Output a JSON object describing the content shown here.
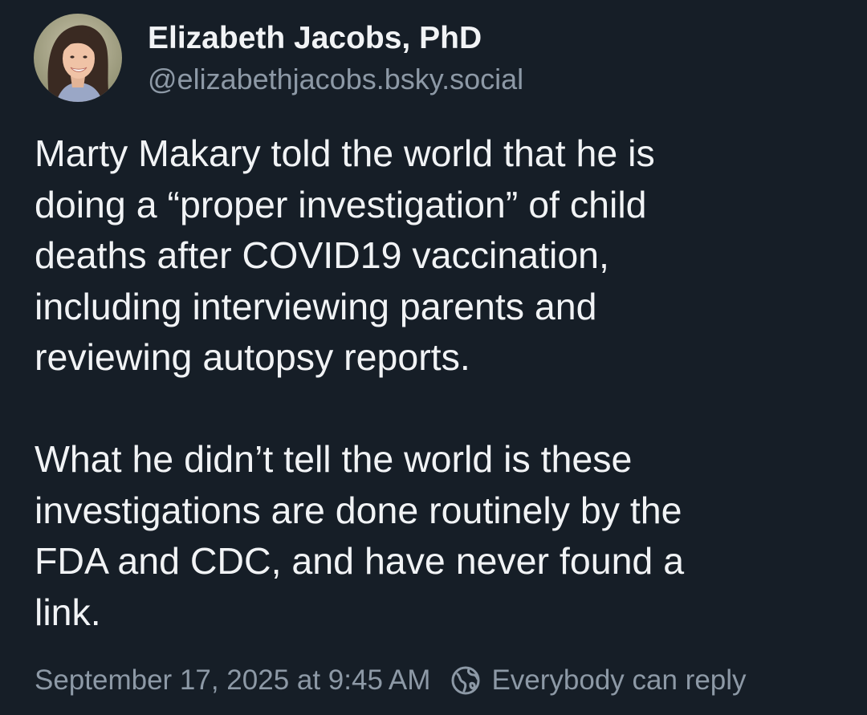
{
  "author": {
    "display_name": "Elizabeth Jacobs, PhD",
    "handle": "@elizabethjacobs.bsky.social",
    "avatar_icon": "profile-photo"
  },
  "post": {
    "paragraphs": [
      "Marty Makary told the world that he is\ndoing a “proper investigation” of child\ndeaths after COVID19 vaccination,\nincluding interviewing parents and\nreviewing autopsy reports.",
      "What he didn’t tell the world is these\ninvestigations are done routinely by the\nFDA and CDC, and have never found a\nlink."
    ]
  },
  "footer": {
    "timestamp": "September 17, 2025 at 9:45 AM",
    "reply_setting_icon": "globe-icon",
    "reply_setting_label": "Everybody can reply"
  },
  "theme": {
    "background": "#161e27",
    "text": "#f1f3f5",
    "muted": "#8d99a6"
  }
}
